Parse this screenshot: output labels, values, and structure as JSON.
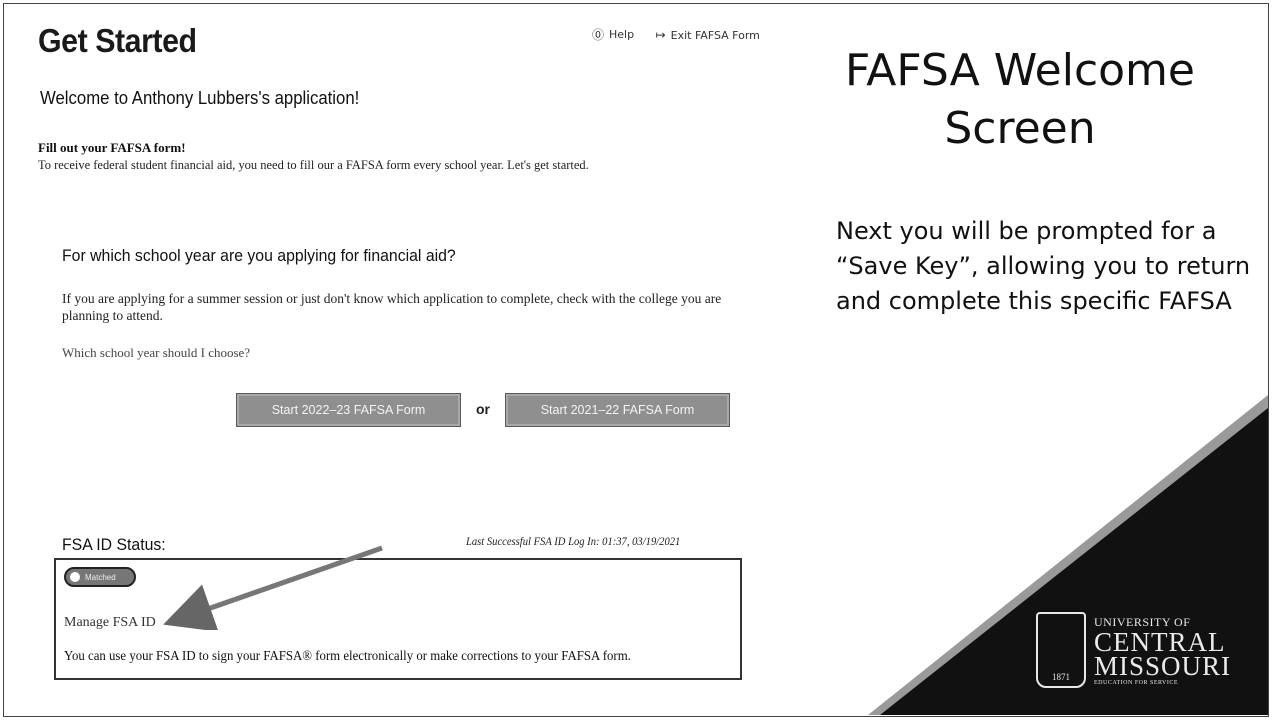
{
  "screenshot": {
    "page_title": "Get Started",
    "header_links": [
      {
        "icon": "help-icon",
        "label": "Help"
      },
      {
        "icon": "exit-icon",
        "label": "Exit FAFSA Form"
      }
    ],
    "welcome": "Welcome to Anthony Lubbers's application!",
    "fill_out": {
      "title": "Fill out your FAFSA form!",
      "text": "To receive federal student financial aid, you need to fill our a FAFSA form every school year. Let's get started."
    },
    "school_year": {
      "question": "For which school year are you applying for financial aid?",
      "help_text": "If you are applying for a summer session or just don't know which application to complete, check with the college you are planning to attend.",
      "which_link": "Which school year should I choose?",
      "buttons": [
        "Start 2022–23 FAFSA Form",
        "Start 2021–22 FAFSA Form"
      ],
      "or": "or"
    },
    "fsa_status": {
      "title": "FSA ID Status:",
      "last_login": "Last Successful FSA ID Log In: 01:37, 03/19/2021",
      "badge": "Matched",
      "manage_link": "Manage FSA ID",
      "description": "You can use your FSA ID to sign your FAFSA® form electronically or make corrections to your FAFSA form."
    }
  },
  "slide": {
    "title": "FAFSA Welcome Screen",
    "body": "Next you will be prompted for a “Save Key”, allowing you to return and complete this specific FAFSA",
    "logo": {
      "line1": "UNIVERSITY OF",
      "line2": "CENTRAL",
      "line3": "MISSOURI",
      "line4": "EDUCATION FOR SERVICE",
      "seal_year": "1871"
    },
    "colors": {
      "wedge": "#111111",
      "wedge_edge": "#9a9a9a",
      "logo": "#eaeaea"
    }
  }
}
